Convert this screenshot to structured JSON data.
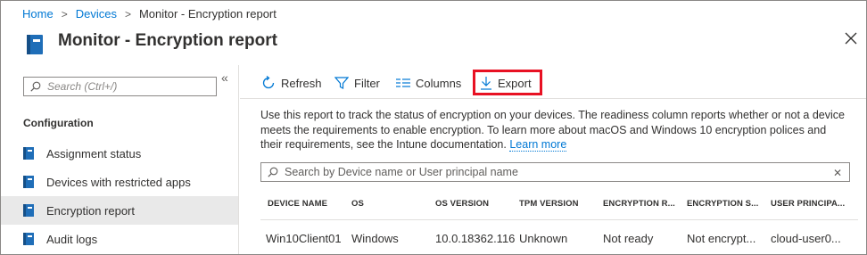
{
  "breadcrumb": {
    "home": "Home",
    "devices": "Devices",
    "current": "Monitor - Encryption report"
  },
  "blade": {
    "title": "Monitor - Encryption report"
  },
  "sidebar": {
    "search_placeholder": "Search (Ctrl+/)",
    "section_label": "Configuration",
    "items": [
      {
        "label": "Assignment status",
        "icon": "book-icon"
      },
      {
        "label": "Devices with restricted apps",
        "icon": "book-icon"
      },
      {
        "label": "Encryption report",
        "icon": "book-icon",
        "active": true
      },
      {
        "label": "Audit logs",
        "icon": "book-icon"
      }
    ]
  },
  "toolbar": {
    "refresh": "Refresh",
    "filter": "Filter",
    "columns": "Columns",
    "export": "Export",
    "highlight_color": "#e81123"
  },
  "description": {
    "text": "Use this report to track the status of encryption on your devices. The readiness column reports whether or not a device meets the requirements to enable encryption. To learn more about macOS and Windows 10 encryption polices and their requirements, see the Intune documentation.",
    "link": "Learn more"
  },
  "device_search": {
    "placeholder": "Search by Device name or User principal name"
  },
  "table": {
    "columns": [
      "DEVICE NAME",
      "OS",
      "OS VERSION",
      "TPM VERSION",
      "ENCRYPTION R...",
      "ENCRYPTION S...",
      "USER PRINCIPA..."
    ],
    "rows": [
      [
        "Win10Client01",
        "Windows",
        "10.0.18362.116",
        "Unknown",
        "Not ready",
        "Not encrypt...",
        "cloud-user0..."
      ]
    ]
  },
  "colors": {
    "accent": "#0078d4",
    "text": "#323130",
    "active_nav_bg": "#e9e9e9",
    "book_icon": "#1f6eb8"
  }
}
